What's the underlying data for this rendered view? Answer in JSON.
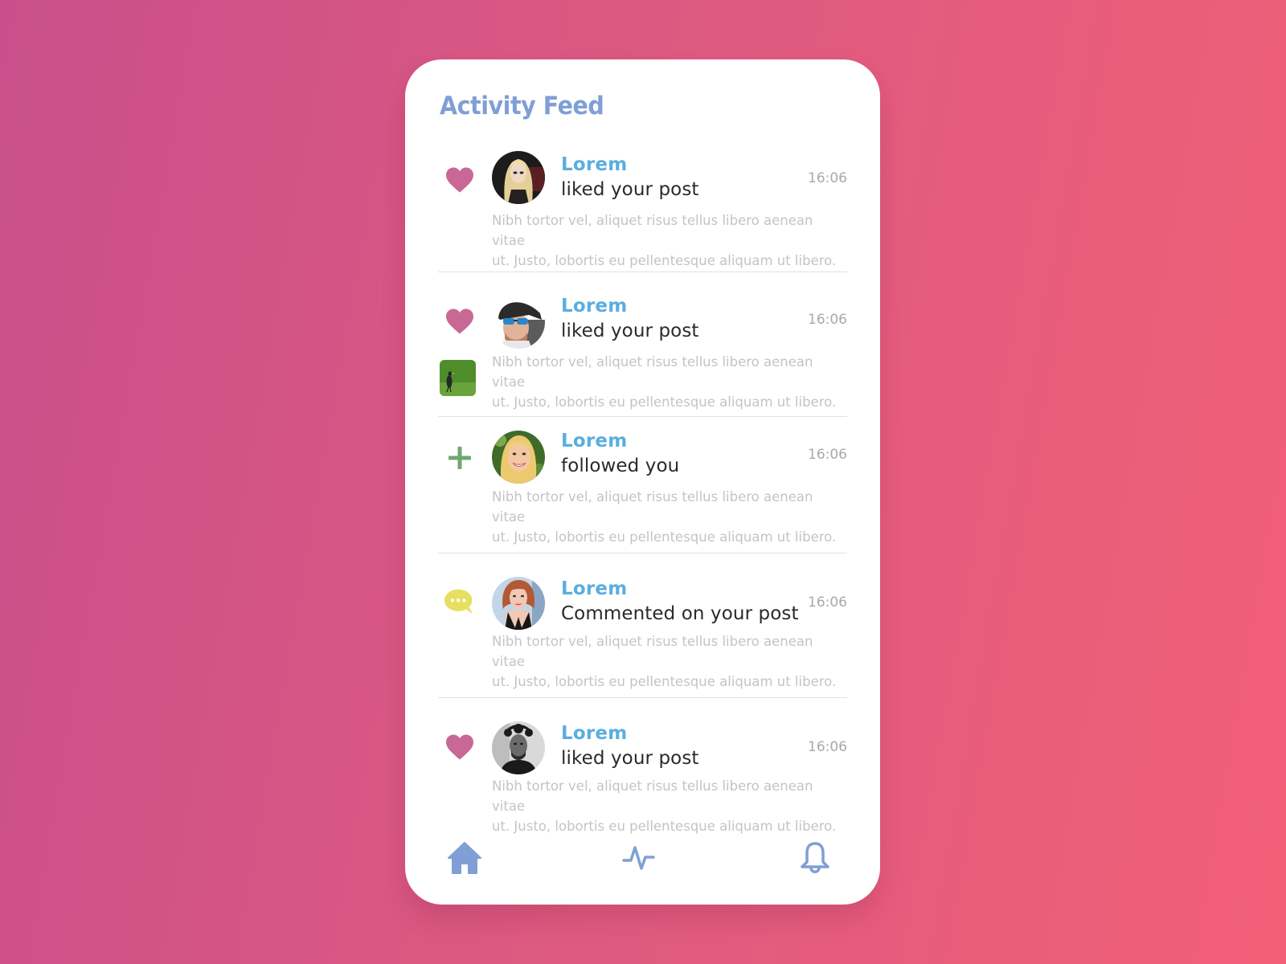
{
  "header": {
    "title": "Activity Feed"
  },
  "colors": {
    "title": "#7f9fd6",
    "name": "#5aaedf",
    "heart": "#c96895",
    "plus": "#6fa86f",
    "comment": "#e6df62",
    "nav": "#7f9fd6",
    "background_start": "#c94f8b",
    "background_end": "#f25f77"
  },
  "feed": [
    {
      "type": "like",
      "icon": "heart-icon",
      "name": "Lorem",
      "action": "liked your post",
      "time": "16:06",
      "desc_line1": "Nibh tortor vel, aliquet risus tellus libero aenean vitae",
      "desc_line2": "ut. Justo, lobortis eu pellentesque aliquam ut libero.",
      "avatar": "blonde woman with dark eye makeup"
    },
    {
      "type": "like",
      "icon": "heart-icon",
      "name": "Lorem",
      "action": "liked your post",
      "time": "16:06",
      "desc_line1": "Nibh tortor vel, aliquet risus tellus libero aenean vitae",
      "desc_line2": "ut. Justo, lobortis eu pellentesque aliquam ut libero.",
      "avatar": "man with cap and blue sunglasses",
      "thumbnail": "bird on grass"
    },
    {
      "type": "follow",
      "icon": "plus-icon",
      "name": "Lorem",
      "action": "followed you",
      "time": "16:06",
      "desc_line1": "Nibh tortor vel, aliquet risus tellus libero aenean vitae",
      "desc_line2": "ut. Justo, lobortis eu pellentesque aliquam ut libero.",
      "avatar": "smiling blonde woman"
    },
    {
      "type": "comment",
      "icon": "comment-icon",
      "name": "Lorem",
      "action": "Commented on your post",
      "time": "16:06",
      "desc_line1": "Nibh tortor vel, aliquet risus tellus libero aenean vitae",
      "desc_line2": "ut. Justo, lobortis eu pellentesque aliquam ut libero.",
      "avatar": "red-haired woman in black dress"
    },
    {
      "type": "like",
      "icon": "heart-icon",
      "name": "Lorem",
      "action": "liked your post",
      "time": "16:06",
      "desc_line1": "Nibh tortor vel, aliquet risus tellus libero aenean vitae",
      "desc_line2": "ut. Justo, lobortis eu pellentesque aliquam ut libero.",
      "avatar": "man with curly hair, black and white"
    }
  ],
  "nav": {
    "items": [
      {
        "name": "home",
        "icon": "home-icon"
      },
      {
        "name": "activity",
        "icon": "activity-icon"
      },
      {
        "name": "notifications",
        "icon": "bell-icon"
      }
    ]
  }
}
